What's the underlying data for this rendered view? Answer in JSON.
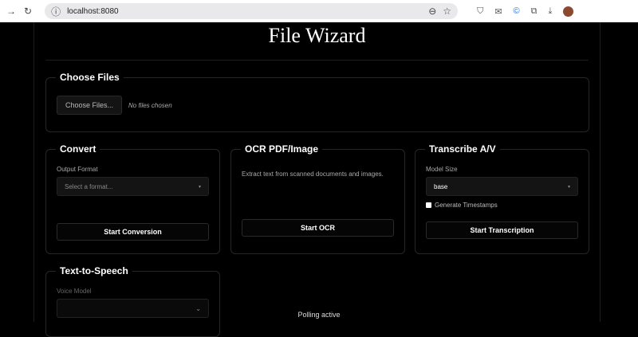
{
  "browser": {
    "url": "localhost:8080"
  },
  "title": "File Wizard",
  "choose_files": {
    "legend": "Choose Files",
    "button": "Choose Files...",
    "status": "No files chosen"
  },
  "convert": {
    "legend": "Convert",
    "label": "Output Format",
    "placeholder": "Select a format...",
    "button": "Start Conversion"
  },
  "ocr": {
    "legend": "OCR PDF/Image",
    "description": "Extract text from scanned documents and images.",
    "button": "Start OCR"
  },
  "transcribe": {
    "legend": "Transcribe A/V",
    "label": "Model Size",
    "value": "base",
    "checkbox": "Generate Timestamps",
    "button": "Start Transcription"
  },
  "tts": {
    "legend": "Text-to-Speech",
    "label": "Voice Model"
  },
  "status": "Polling active"
}
